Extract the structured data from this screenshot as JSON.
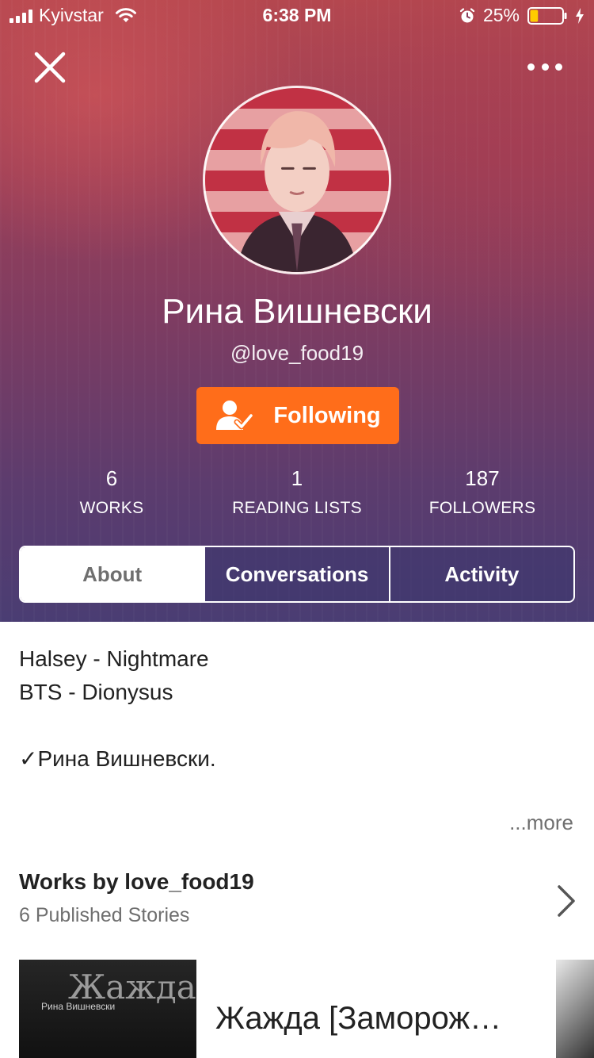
{
  "status_bar": {
    "carrier": "Kyivstar",
    "time": "6:38 PM",
    "battery_percent": "25%",
    "battery_level": 0.25,
    "battery_color": "#ffcc00"
  },
  "header": {
    "close_icon": "close-icon",
    "more_icon": "more-horizontal-icon"
  },
  "profile": {
    "display_name": "Рина Вишневски",
    "username": "@love_food19",
    "follow_button_label": "Following",
    "follow_button_color": "#ff6d1a",
    "follow_icon": "user-check-icon"
  },
  "stats": [
    {
      "value": "6",
      "label": "WORKS"
    },
    {
      "value": "1",
      "label": "READING LISTS"
    },
    {
      "value": "187",
      "label": "FOLLOWERS"
    }
  ],
  "tabs": [
    {
      "label": "About",
      "active": true
    },
    {
      "label": "Conversations",
      "active": false
    },
    {
      "label": "Activity",
      "active": false
    }
  ],
  "about": {
    "lines": [
      "Halsey - Nightmare",
      "BTS - Dionysus",
      "",
      "✓Рина Вишневски."
    ],
    "more_label": "...more"
  },
  "works": {
    "title": "Works by love_food19",
    "subtitle": "6 Published Stories",
    "stories": [
      {
        "cover_title": "Жажда",
        "cover_author": "Рина Вишневски",
        "title": "Жажда [Заморожено]"
      }
    ]
  }
}
